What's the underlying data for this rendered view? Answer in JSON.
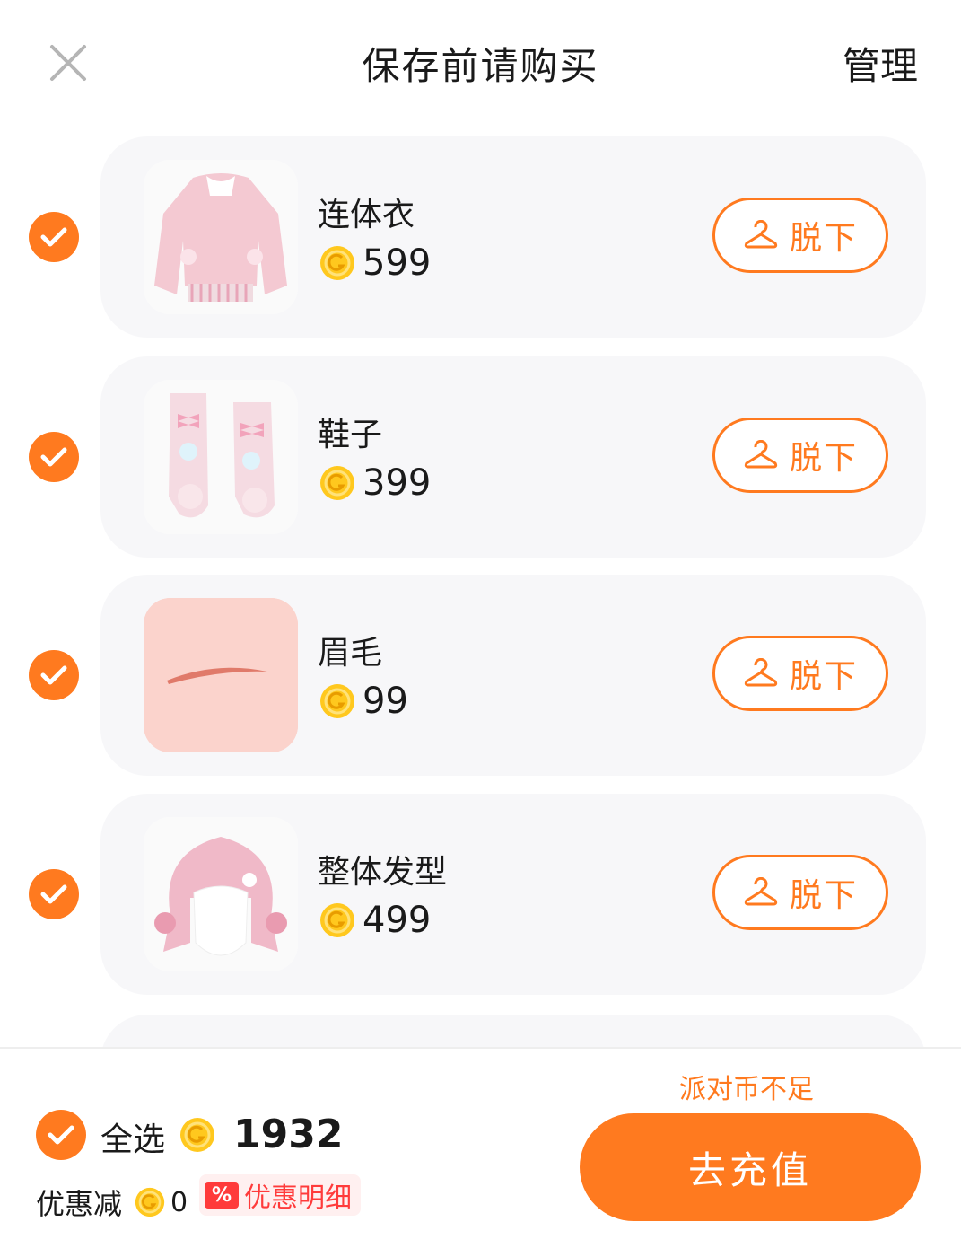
{
  "header": {
    "title": "保存前请购买",
    "manage_label": "管理"
  },
  "items": [
    {
      "name": "连体衣",
      "price": "599",
      "remove_label": "脱下",
      "thumb": "pink-onesie-outfit"
    },
    {
      "name": "鞋子",
      "price": "399",
      "remove_label": "脱下",
      "thumb": "pink-bunny-boots"
    },
    {
      "name": "眉毛",
      "price": "99",
      "remove_label": "脱下",
      "thumb": "eyebrow"
    },
    {
      "name": "整体发型",
      "price": "499",
      "remove_label": "脱下",
      "thumb": "pink-bob-hairstyle"
    }
  ],
  "footer": {
    "select_all_label": "全选",
    "total": "1932",
    "discount_label": "优惠减",
    "discount_value": "0",
    "discount_badge_icon": "%",
    "discount_detail_label": "优惠明细",
    "insufficient_text": "派对币不足",
    "recharge_label": "去充值"
  },
  "colors": {
    "accent": "#ff7a1f",
    "card_bg": "#f7f7f9",
    "coin": "#ffc81e",
    "discount_red": "#ff3b3b"
  },
  "icons": {
    "close": "close-icon",
    "check": "check-icon",
    "coin": "coin-icon",
    "hanger": "hanger-icon"
  }
}
